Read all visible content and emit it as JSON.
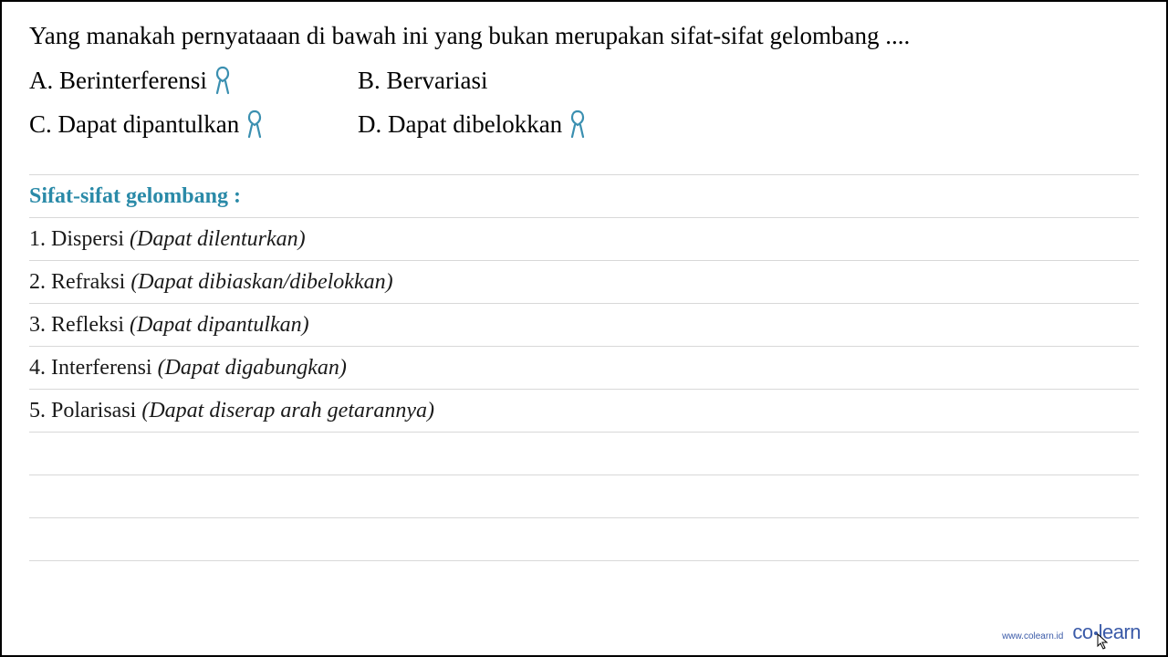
{
  "question": {
    "text": "Yang manakah pernyataaan di bawah ini yang bukan merupakan sifat-sifat gelombang ....",
    "options": {
      "A": {
        "label": "A. Berinterferensi",
        "ribbon": true
      },
      "B": {
        "label": "B. Bervariasi",
        "ribbon": false
      },
      "C": {
        "label": "C. Dapat dipantulkan",
        "ribbon": true
      },
      "D": {
        "label": "D. Dapat dibelokkan",
        "ribbon": true
      }
    }
  },
  "answer": {
    "heading": "Sifat-sifat gelombang :",
    "items": [
      {
        "num": "1.",
        "term": "Dispersi",
        "detail": "(Dapat dilenturkan)"
      },
      {
        "num": "2.",
        "term": "Refraksi",
        "detail": "(Dapat dibiaskan/dibelokkan)"
      },
      {
        "num": "3.",
        "term": "Refleksi",
        "detail": "(Dapat dipantulkan)"
      },
      {
        "num": "4.",
        "term": "Interferensi",
        "detail": "(Dapat digabungkan)"
      },
      {
        "num": "5.",
        "term": "Polarisasi",
        "detail": "(Dapat diserap arah getarannya)"
      }
    ]
  },
  "footer": {
    "url": "www.colearn.id",
    "logo_part1": "co",
    "logo_part2": "learn"
  }
}
